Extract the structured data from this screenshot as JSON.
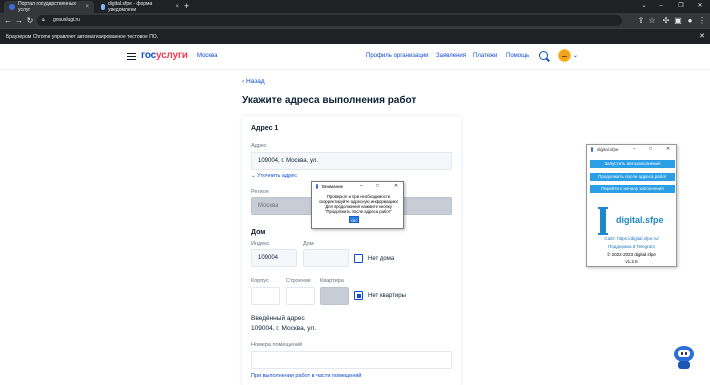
{
  "browser": {
    "tabs": [
      {
        "title": "Портал государственных услуг"
      },
      {
        "title": "digital.sfpe - форма уведомлени"
      }
    ],
    "url": "gosuslugi.ru",
    "infobar": "Браузером Chrome управляет автоматизированное тестовое ПО."
  },
  "header": {
    "logo_first": "гос",
    "logo_second": "услуги",
    "region": "Москва",
    "nav": [
      "Профиль организации",
      "Заявления",
      "Платежи",
      "Помощь"
    ]
  },
  "page": {
    "back": "Назад",
    "title": "Укажите адреса выполнения работ"
  },
  "form": {
    "section1": "Адрес 1",
    "address_label": "Адрес",
    "address_value": "109004, г. Москва, ул.",
    "refine_link": "Уточнить адрес",
    "region_label": "Регион",
    "region_value": "Москва",
    "house_section": "Дом",
    "index_label": "Индекс",
    "index_value": "109004",
    "house_label": "Дом",
    "no_house": "Нет дома",
    "korpus_label": "Корпус",
    "stroenie_label": "Строение",
    "apartment_label": "Квартира",
    "no_apartment": "Нет квартиры",
    "entered_label": "Введённый адрес",
    "entered_value": "109004, г. Москва, ул.",
    "rooms_label": "Номера помещений",
    "partial_link": "При выполнении работ в части помещений"
  },
  "dialog": {
    "title": "Внимание",
    "message_lines": [
      "Проверьте и при необходимости",
      "скорректируйте адресную информацию!",
      "Для продолжения нажмите кнопку",
      "\"Продолжить после адреса работ\""
    ],
    "ok": "OK"
  },
  "panel": {
    "title": "digital.sfpe",
    "btn_start": "Запустить автозаполнение",
    "btn_continue": "Продолжить после адреса работ",
    "btn_goto": "Перейти к началу заполнения",
    "brand": "digital.sfpe",
    "site": "Сайт: https://digital.sfpe.ru/",
    "telegram": "Поддержка в Telegram",
    "copyright": "© 2022-2023 digital.sfpe",
    "version": "v1.2.6"
  }
}
